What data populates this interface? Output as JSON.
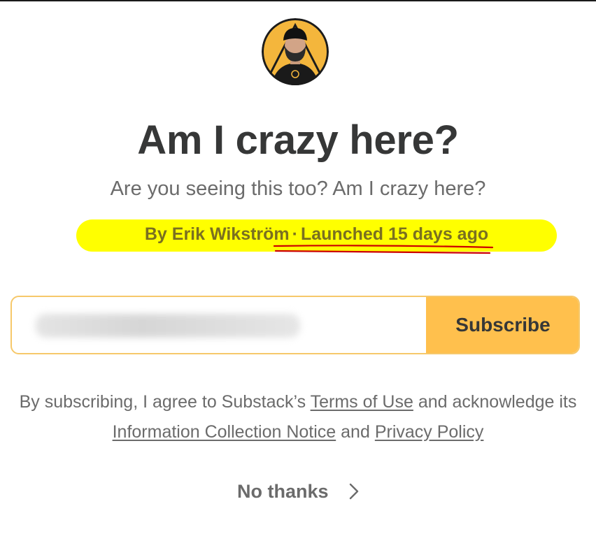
{
  "publication": {
    "title": "Am I crazy here?",
    "tagline": "Are you seeing this too? Am I crazy here?",
    "author_prefix": "By Erik Wikström",
    "separator": "·",
    "launched": "Launched 15 days ago"
  },
  "form": {
    "email_value": "",
    "subscribe_label": "Subscribe"
  },
  "legal": {
    "prefix": "By subscribing, I agree to Substack’s",
    "terms_link": "Terms of Use",
    "middle": "and acknowledge its",
    "notice_link": "Information Collection Notice",
    "and": "and",
    "privacy_link": "Privacy Policy"
  },
  "dismiss": {
    "label": "No thanks"
  },
  "colors": {
    "accent": "#ffc04d",
    "highlight": "#ffff00",
    "annotation": "#cc0000"
  },
  "icons": {
    "avatar": "author-avatar",
    "dismiss": "chevron-right-icon"
  }
}
